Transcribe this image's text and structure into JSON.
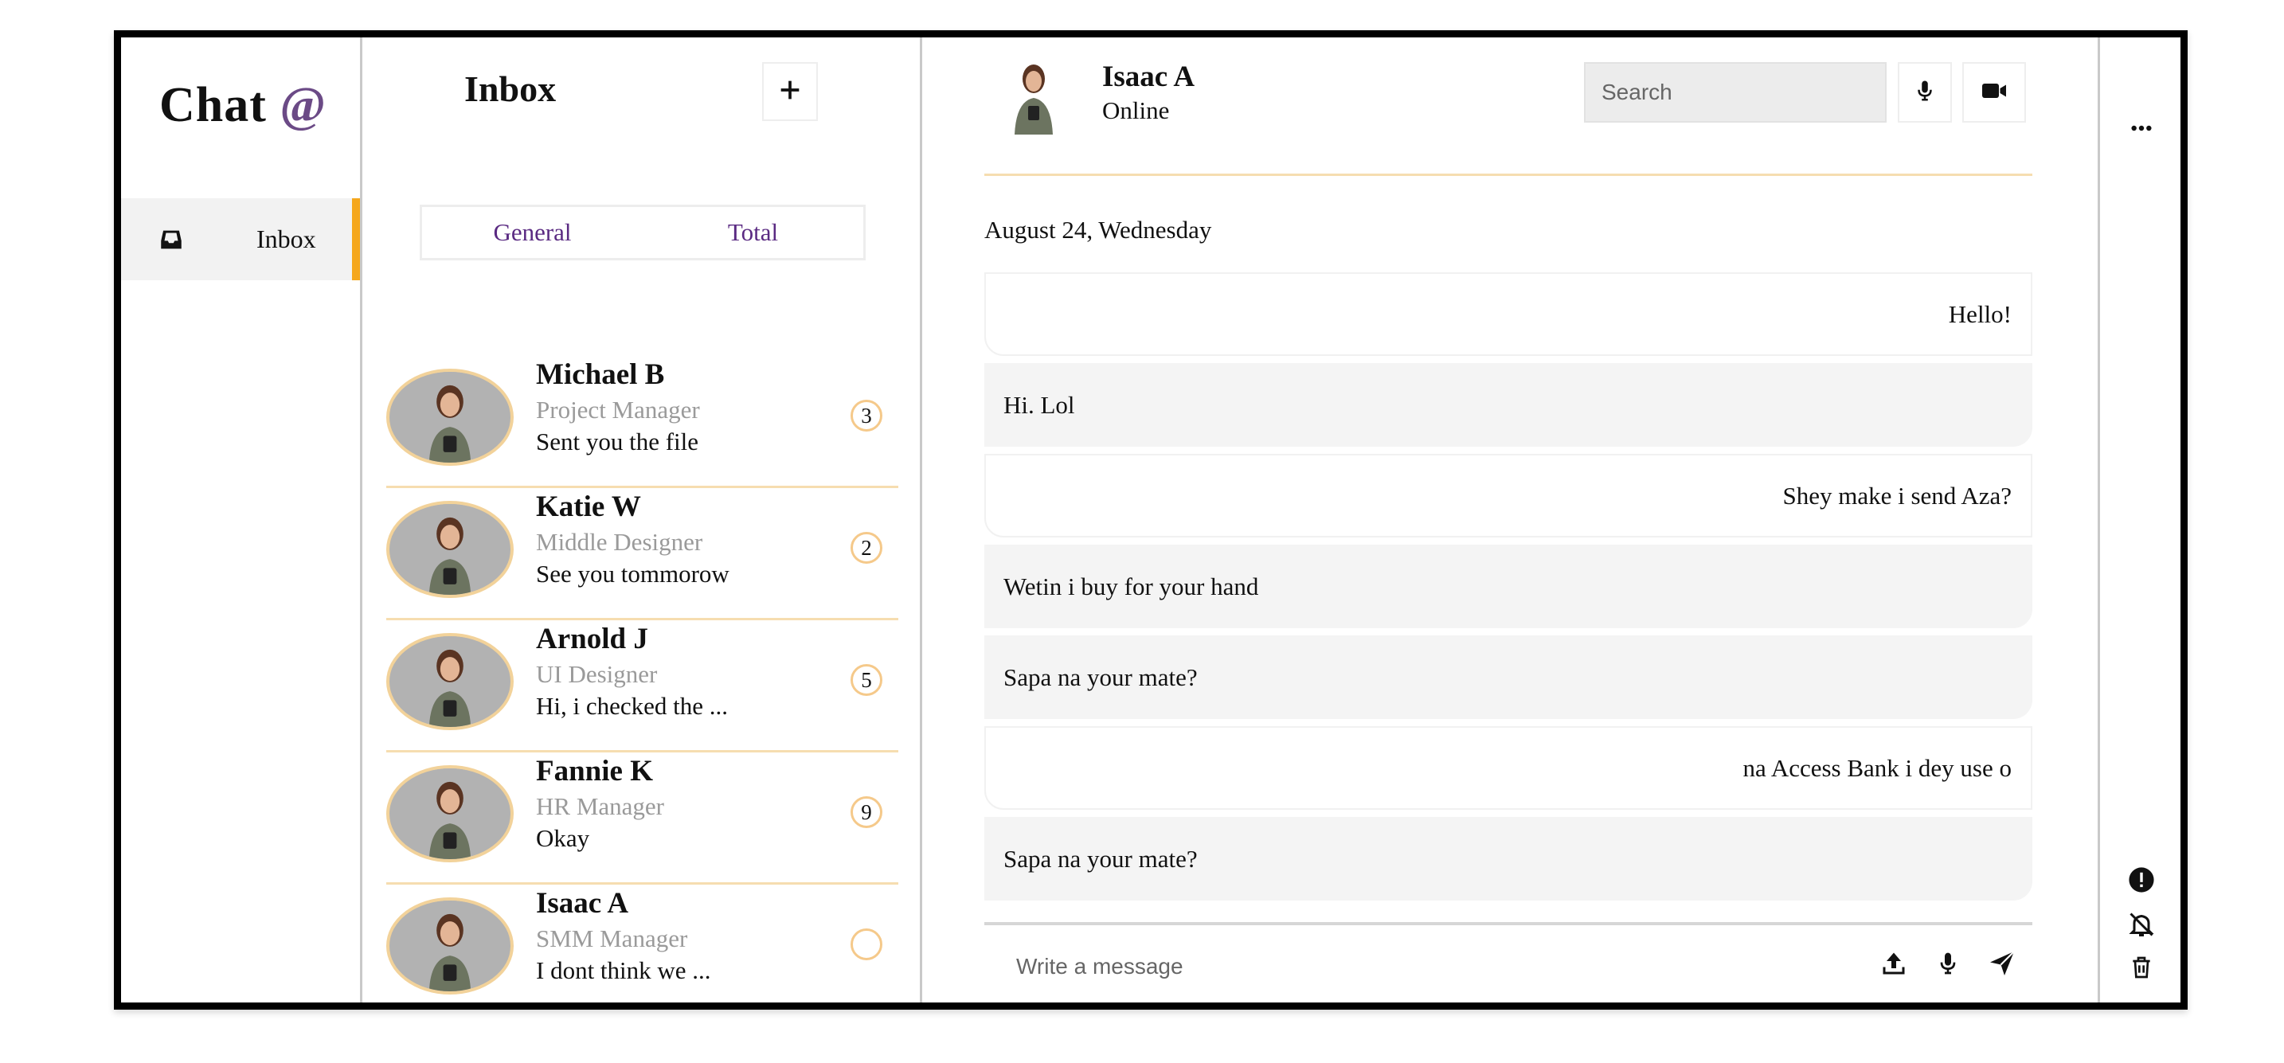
{
  "app": {
    "logo_text": "Chat",
    "logo_symbol": "@",
    "accent_color": "#f5a71d",
    "brand_color": "#6b4a86"
  },
  "nav": {
    "items": [
      {
        "label": "Inbox",
        "icon": "inbox-icon",
        "active": true
      }
    ]
  },
  "inbox": {
    "title": "Inbox",
    "add_icon": "plus-icon",
    "tabs": [
      {
        "label": "General"
      },
      {
        "label": "Total"
      }
    ],
    "contacts": [
      {
        "name": "Michael B",
        "role": "Project Manager",
        "last_message": "Sent you the file",
        "unread": "3"
      },
      {
        "name": "Katie W",
        "role": "Middle Designer",
        "last_message": "See you tommorow",
        "unread": "2"
      },
      {
        "name": "Arnold J",
        "role": "UI Designer",
        "last_message": "Hi, i checked the ...",
        "unread": "5"
      },
      {
        "name": "Fannie K",
        "role": "HR Manager",
        "last_message": "Okay",
        "unread": "9"
      },
      {
        "name": "Isaac A",
        "role": "SMM Manager",
        "last_message": "I dont think we ...",
        "unread": ""
      }
    ]
  },
  "chat": {
    "contact_name": "Isaac A",
    "status": "Online",
    "search_placeholder": "Search",
    "date_label": "August 24, Wednesday",
    "messages": [
      {
        "text": "Hello!",
        "direction": "out"
      },
      {
        "text": "Hi. Lol",
        "direction": "in"
      },
      {
        "text": "Shey make i send Aza?",
        "direction": "out"
      },
      {
        "text": "Wetin i buy for your hand",
        "direction": "in"
      },
      {
        "text": "Sapa na your mate?",
        "direction": "in"
      },
      {
        "text": "na Access Bank i dey use o",
        "direction": "out"
      },
      {
        "text": "Sapa na your mate?",
        "direction": "in"
      }
    ],
    "composer_placeholder": "Write a message",
    "header_icons": [
      "microphone-icon",
      "video-camera-icon"
    ],
    "composer_icons": [
      "upload-icon",
      "microphone-icon",
      "send-icon"
    ]
  },
  "rail": {
    "icons": [
      "more-options-icon",
      "alert-icon",
      "mute-notifications-icon",
      "trash-icon"
    ]
  }
}
